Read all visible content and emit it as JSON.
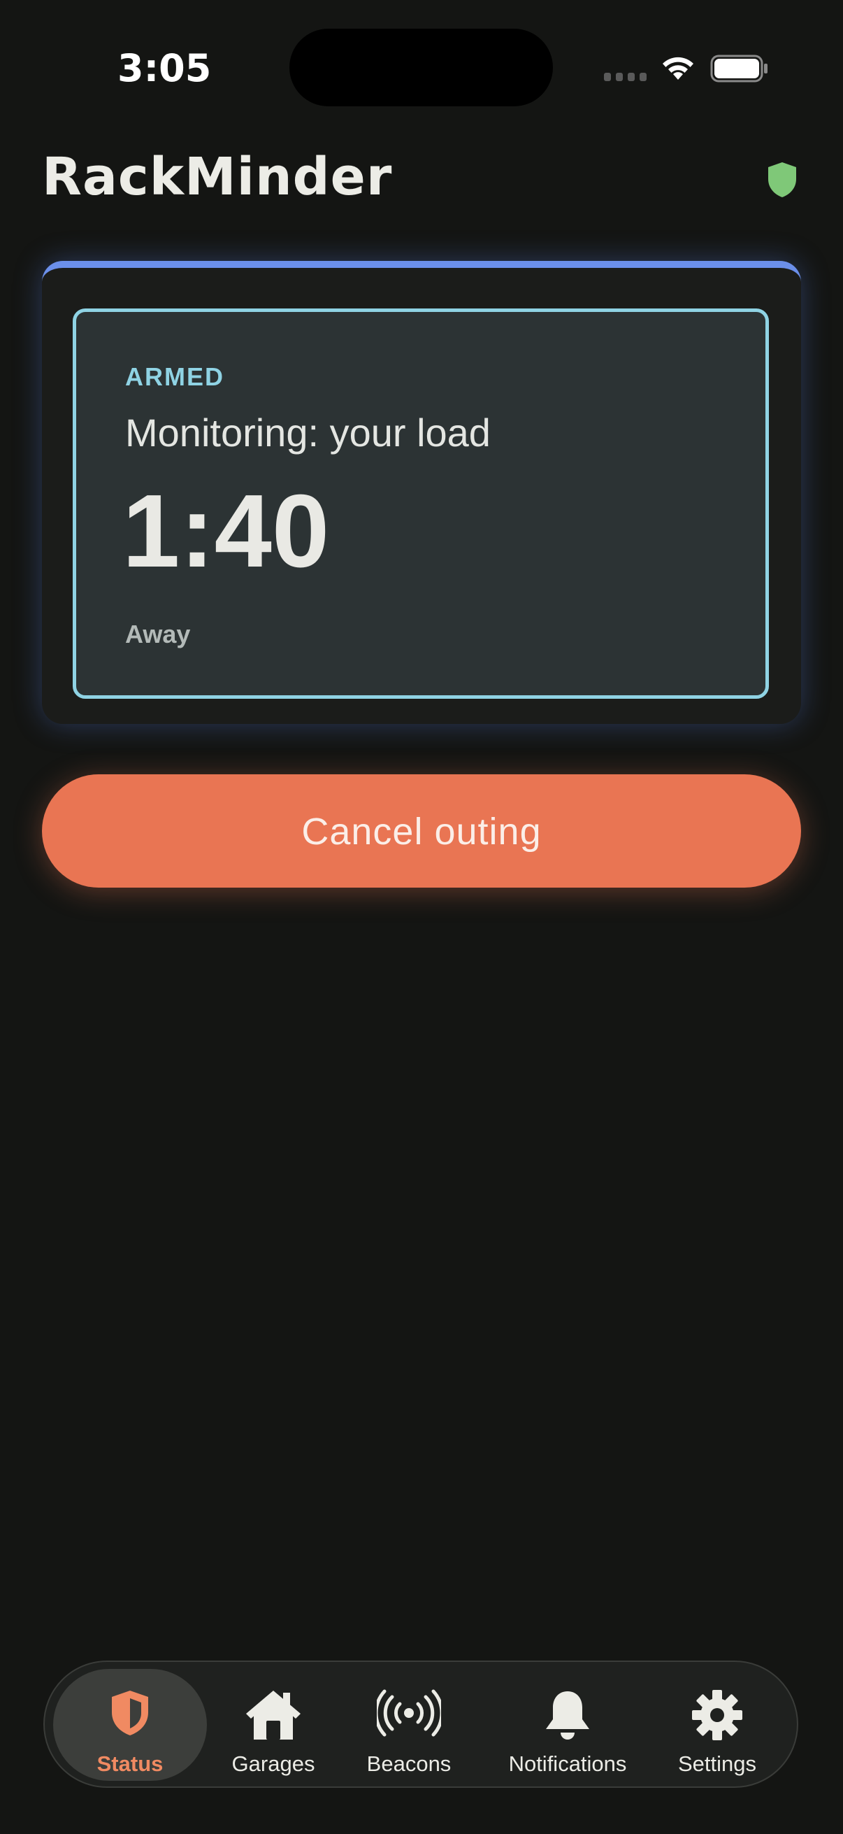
{
  "status_bar": {
    "time": "3:05"
  },
  "header": {
    "title": "RackMinder",
    "badge_icon": "shield-icon",
    "badge_color": "#7fc878"
  },
  "status_card": {
    "state_label": "ARMED",
    "monitoring_text": "Monitoring: your load",
    "countdown": "1:40",
    "mode_label": "Away",
    "accent_color": "#6b8fea",
    "border_color": "#8fd3e4"
  },
  "actions": {
    "cancel_label": "Cancel outing",
    "cancel_color": "#e97553"
  },
  "tabs": [
    {
      "label": "Status",
      "icon": "shield-icon",
      "active": true
    },
    {
      "label": "Garages",
      "icon": "house-icon",
      "active": false
    },
    {
      "label": "Beacons",
      "icon": "broadcast-icon",
      "active": false
    },
    {
      "label": "Notifications",
      "icon": "bell-icon",
      "active": false
    },
    {
      "label": "Settings",
      "icon": "gear-icon",
      "active": false
    }
  ]
}
